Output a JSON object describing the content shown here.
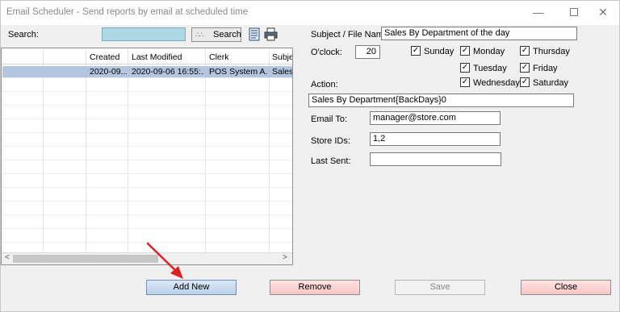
{
  "window": {
    "title": "Email Scheduler - Send reports by email at scheduled time",
    "controls": {
      "minimize": "—",
      "close": "✕"
    }
  },
  "search": {
    "label": "Search:",
    "value": "",
    "button_label": "Search",
    "button_dots": "∴∴"
  },
  "table": {
    "columns": [
      "",
      "Created",
      "Last Modified",
      "Clerk",
      "Subje"
    ],
    "rows": [
      [
        "",
        "2020-09...",
        "2020-09-06 16:55:...",
        "POS System A...",
        "Sales"
      ]
    ],
    "scroll_left": "<",
    "scroll_right": ">"
  },
  "form": {
    "subject_label": "Subject / File Name:",
    "subject_value": "Sales By Department of the day",
    "oclock_label": "O'clock:",
    "oclock_value": "20",
    "action_label": "Action:",
    "action_value": "Sales By Department{BackDays}0",
    "email_label": "Email To:",
    "email_value": "manager@store.com",
    "store_label": "Store IDs:",
    "store_value": "1,2",
    "last_sent_label": "Last Sent:",
    "last_sent_value": ""
  },
  "days": {
    "sunday": {
      "label": "Sunday",
      "checked": true
    },
    "monday": {
      "label": "Monday",
      "checked": true
    },
    "tuesday": {
      "label": "Tuesday",
      "checked": true
    },
    "wednesday": {
      "label": "Wednesday",
      "checked": true
    },
    "thursday": {
      "label": "Thursday",
      "checked": true
    },
    "friday": {
      "label": "Friday",
      "checked": true
    },
    "saturday": {
      "label": "Saturday",
      "checked": true
    },
    "check_glyph": "✓"
  },
  "buttons": {
    "add_new": "Add New",
    "remove": "Remove",
    "save": "Save",
    "close": "Close"
  },
  "icons": {
    "document": "document-icon",
    "print": "printer-icon"
  },
  "colors": {
    "selection": "#b4c6df",
    "search_box": "#add8e6",
    "annotation_arrow": "#e02020"
  }
}
